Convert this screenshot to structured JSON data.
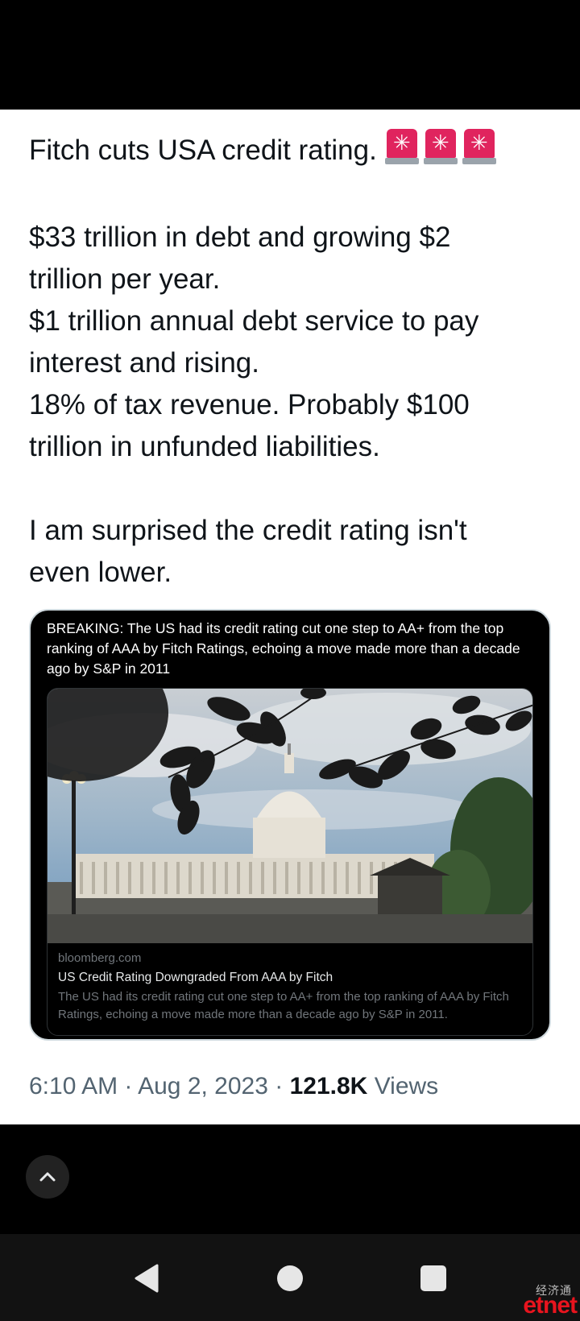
{
  "tweet": {
    "line1": "Fitch cuts USA credit rating.",
    "emoji_icons": [
      "police-car-light-icon",
      "police-car-light-icon",
      "police-car-light-icon"
    ],
    "body": "$33 trillion in debt and growing $2\ntrillion per year.\n$1 trillion annual debt service to pay\ninterest and rising.\n18% of tax revenue. Probably $100\ntrillion in unfunded liabilities.\n\nI am surprised the credit rating isn't\neven lower."
  },
  "quoted_tweet": {
    "text": "BREAKING: The US had its credit rating cut one step to AA+ from the top ranking of AAA by Fitch Ratings, echoing a move made more than a decade ago by S&P in 2011",
    "link": {
      "domain": "bloomberg.com",
      "title": "US Credit Rating Downgraded From AAA by Fitch",
      "description": "The US had its credit rating cut one step to AA+ from the top ranking of AAA by Fitch Ratings, echoing a move made more than a decade ago by S&P in 2011."
    }
  },
  "meta": {
    "time": "6:10 AM",
    "separator": "·",
    "date": "Aug 2, 2023",
    "views_count": "121.8K",
    "views_label": "Views"
  },
  "watermark": {
    "cn": "经济通",
    "en": "etnet"
  },
  "colors": {
    "text_primary": "#0f1419",
    "text_secondary": "#536471",
    "siren_red": "#e0245e",
    "watermark_red": "#e8141e"
  }
}
